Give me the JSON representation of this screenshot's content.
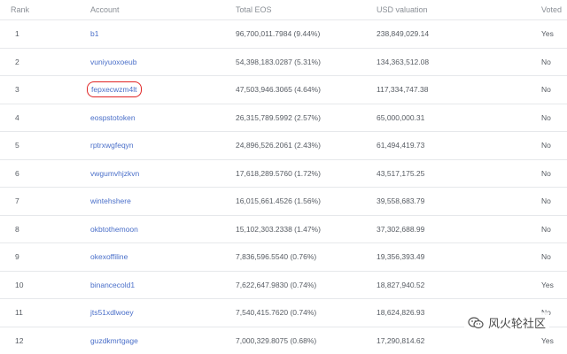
{
  "headers": {
    "rank": "Rank",
    "account": "Account",
    "total": "Total EOS",
    "usd": "USD valuation",
    "voted": "Voted"
  },
  "rows": [
    {
      "rank": "1",
      "account": "b1",
      "total": "96,700,011.7984 (9.44%)",
      "usd": "238,849,029.14",
      "voted": "Yes",
      "highlighted": false
    },
    {
      "rank": "2",
      "account": "vuniyuoxoeub",
      "total": "54,398,183.0287 (5.31%)",
      "usd": "134,363,512.08",
      "voted": "No",
      "highlighted": false
    },
    {
      "rank": "3",
      "account": "fepxecwzm4lt",
      "total": "47,503,946.3065 (4.64%)",
      "usd": "117,334,747.38",
      "voted": "No",
      "highlighted": true
    },
    {
      "rank": "4",
      "account": "eospstotoken",
      "total": "26,315,789.5992 (2.57%)",
      "usd": "65,000,000.31",
      "voted": "No",
      "highlighted": false
    },
    {
      "rank": "5",
      "account": "rptrxwgfeqyn",
      "total": "24,896,526.2061 (2.43%)",
      "usd": "61,494,419.73",
      "voted": "No",
      "highlighted": false
    },
    {
      "rank": "6",
      "account": "vwgumvhjzkvn",
      "total": "17,618,289.5760 (1.72%)",
      "usd": "43,517,175.25",
      "voted": "No",
      "highlighted": false
    },
    {
      "rank": "7",
      "account": "wintehshere",
      "total": "16,015,661.4526 (1.56%)",
      "usd": "39,558,683.79",
      "voted": "No",
      "highlighted": false
    },
    {
      "rank": "8",
      "account": "okbtothemoon",
      "total": "15,102,303.2338 (1.47%)",
      "usd": "37,302,688.99",
      "voted": "No",
      "highlighted": false
    },
    {
      "rank": "9",
      "account": "okexoffiline",
      "total": "7,836,596.5540 (0.76%)",
      "usd": "19,356,393.49",
      "voted": "No",
      "highlighted": false
    },
    {
      "rank": "10",
      "account": "binancecold1",
      "total": "7,622,647.9830 (0.74%)",
      "usd": "18,827,940.52",
      "voted": "Yes",
      "highlighted": false
    },
    {
      "rank": "11",
      "account": "jts51xdlwoey",
      "total": "7,540,415.7620 (0.74%)",
      "usd": "18,624,826.93",
      "voted": "No",
      "highlighted": false
    },
    {
      "rank": "12",
      "account": "guzdkmrtgage",
      "total": "7,000,329.8075 (0.68%)",
      "usd": "17,290,814.62",
      "voted": "Yes",
      "highlighted": false
    }
  ],
  "watermark": {
    "text": "风火轮社区",
    "icon": "wechat-icon"
  }
}
